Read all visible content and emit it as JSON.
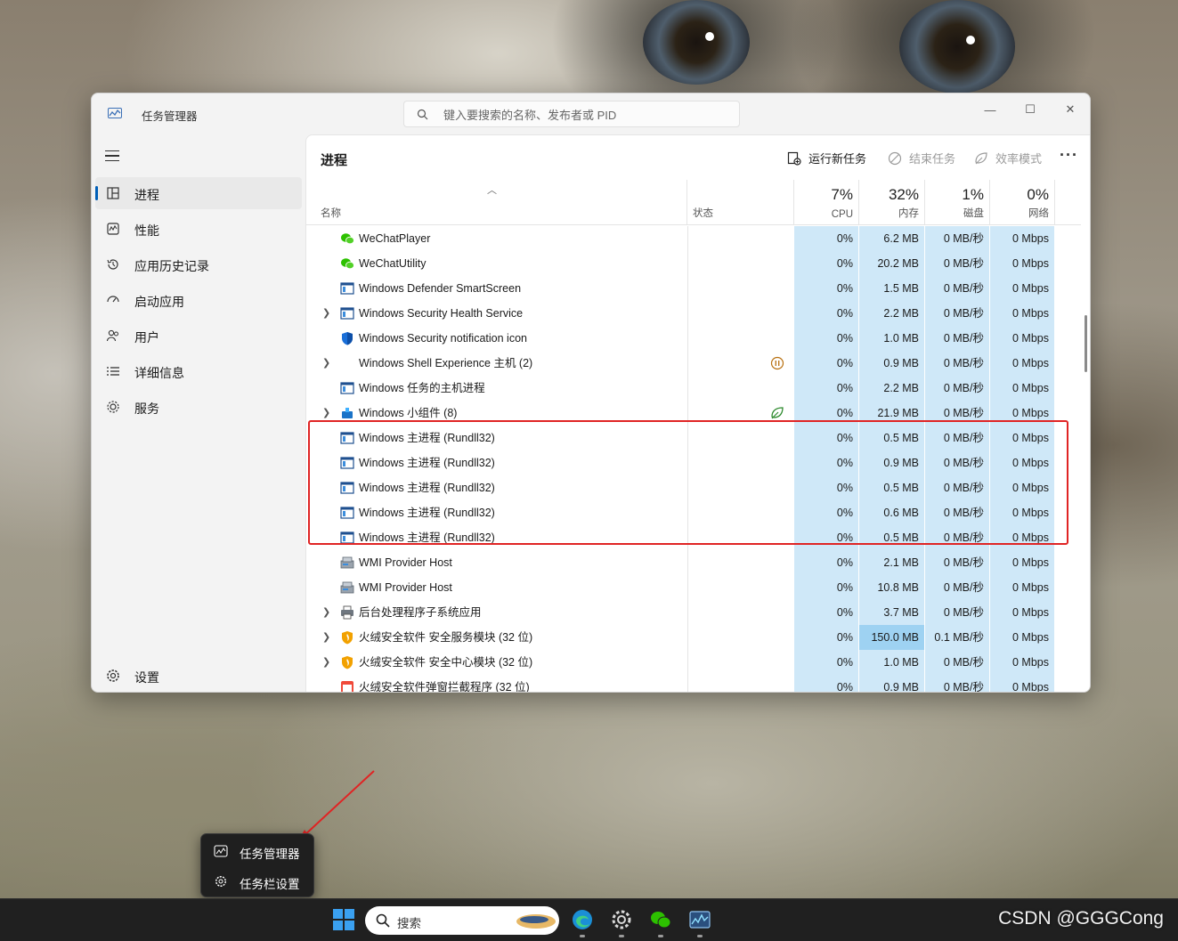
{
  "window": {
    "title": "任务管理器",
    "search_placeholder": "键入要搜索的名称、发布者或 PID",
    "minimize": "—",
    "maximize": "☐",
    "close": "✕"
  },
  "sidebar": {
    "items": [
      {
        "label": "进程",
        "icon": "processes-icon"
      },
      {
        "label": "性能",
        "icon": "performance-icon"
      },
      {
        "label": "应用历史记录",
        "icon": "app-history-icon"
      },
      {
        "label": "启动应用",
        "icon": "startup-icon"
      },
      {
        "label": "用户",
        "icon": "users-icon"
      },
      {
        "label": "详细信息",
        "icon": "details-icon"
      },
      {
        "label": "服务",
        "icon": "services-icon"
      }
    ],
    "settings": "设置"
  },
  "main": {
    "title": "进程",
    "toolbar": {
      "run_new_task": "运行新任务",
      "end_task": "结束任务",
      "efficiency_mode": "效率模式",
      "more": "···"
    }
  },
  "columns": {
    "name": "名称",
    "status": "状态",
    "cpu": {
      "pct": "7%",
      "label": "CPU"
    },
    "memory": {
      "pct": "32%",
      "label": "内存"
    },
    "disk": {
      "pct": "1%",
      "label": "磁盘"
    },
    "network": {
      "pct": "0%",
      "label": "网络"
    }
  },
  "processes": [
    {
      "name": "WeChatPlayer",
      "expand": false,
      "icon": "wechat-icon",
      "status": "",
      "cpu": "0%",
      "mem": "6.2 MB",
      "disk": "0 MB/秒",
      "net": "0 Mbps"
    },
    {
      "name": "WeChatUtility",
      "expand": false,
      "icon": "wechat-icon",
      "status": "",
      "cpu": "0%",
      "mem": "20.2 MB",
      "disk": "0 MB/秒",
      "net": "0 Mbps"
    },
    {
      "name": "Windows Defender SmartScreen",
      "expand": false,
      "icon": "window-app-icon",
      "status": "",
      "cpu": "0%",
      "mem": "1.5 MB",
      "disk": "0 MB/秒",
      "net": "0 Mbps"
    },
    {
      "name": "Windows Security Health Service",
      "expand": true,
      "icon": "window-app-icon",
      "status": "",
      "cpu": "0%",
      "mem": "2.2 MB",
      "disk": "0 MB/秒",
      "net": "0 Mbps"
    },
    {
      "name": "Windows Security notification icon",
      "expand": false,
      "icon": "shield-icon",
      "status": "",
      "cpu": "0%",
      "mem": "1.0 MB",
      "disk": "0 MB/秒",
      "net": "0 Mbps"
    },
    {
      "name": "Windows Shell Experience 主机 (2)",
      "expand": true,
      "icon": "none",
      "status": "suspended",
      "cpu": "0%",
      "mem": "0.9 MB",
      "disk": "0 MB/秒",
      "net": "0 Mbps"
    },
    {
      "name": "Windows 任务的主机进程",
      "expand": false,
      "icon": "window-app-icon",
      "status": "",
      "cpu": "0%",
      "mem": "2.2 MB",
      "disk": "0 MB/秒",
      "net": "0 Mbps"
    },
    {
      "name": "Windows 小组件 (8)",
      "expand": true,
      "icon": "widgets-icon",
      "status": "efficiency",
      "cpu": "0%",
      "mem": "21.9 MB",
      "disk": "0 MB/秒",
      "net": "0 Mbps"
    },
    {
      "name": "Windows 主进程 (Rundll32)",
      "expand": false,
      "icon": "window-app-icon",
      "status": "",
      "cpu": "0%",
      "mem": "0.5 MB",
      "disk": "0 MB/秒",
      "net": "0 Mbps"
    },
    {
      "name": "Windows 主进程 (Rundll32)",
      "expand": false,
      "icon": "window-app-icon",
      "status": "",
      "cpu": "0%",
      "mem": "0.9 MB",
      "disk": "0 MB/秒",
      "net": "0 Mbps"
    },
    {
      "name": "Windows 主进程 (Rundll32)",
      "expand": false,
      "icon": "window-app-icon",
      "status": "",
      "cpu": "0%",
      "mem": "0.5 MB",
      "disk": "0 MB/秒",
      "net": "0 Mbps"
    },
    {
      "name": "Windows 主进程 (Rundll32)",
      "expand": false,
      "icon": "window-app-icon",
      "status": "",
      "cpu": "0%",
      "mem": "0.6 MB",
      "disk": "0 MB/秒",
      "net": "0 Mbps"
    },
    {
      "name": "Windows 主进程 (Rundll32)",
      "expand": false,
      "icon": "window-app-icon",
      "status": "",
      "cpu": "0%",
      "mem": "0.5 MB",
      "disk": "0 MB/秒",
      "net": "0 Mbps"
    },
    {
      "name": "WMI Provider Host",
      "expand": false,
      "icon": "wmi-icon",
      "status": "",
      "cpu": "0%",
      "mem": "2.1 MB",
      "disk": "0 MB/秒",
      "net": "0 Mbps"
    },
    {
      "name": "WMI Provider Host",
      "expand": false,
      "icon": "wmi-icon",
      "status": "",
      "cpu": "0%",
      "mem": "10.8 MB",
      "disk": "0 MB/秒",
      "net": "0 Mbps"
    },
    {
      "name": "后台处理程序子系统应用",
      "expand": true,
      "icon": "printer-icon",
      "status": "",
      "cpu": "0%",
      "mem": "3.7 MB",
      "disk": "0 MB/秒",
      "net": "0 Mbps"
    },
    {
      "name": "火绒安全软件 安全服务模块 (32 位)",
      "expand": true,
      "icon": "huorong-icon",
      "status": "",
      "cpu": "0%",
      "mem": "150.0 MB",
      "disk": "0.1 MB/秒",
      "net": "0 Mbps",
      "hot": true
    },
    {
      "name": "火绒安全软件 安全中心模块 (32 位)",
      "expand": true,
      "icon": "huorong-icon",
      "status": "",
      "cpu": "0%",
      "mem": "1.0 MB",
      "disk": "0 MB/秒",
      "net": "0 Mbps"
    },
    {
      "name": "火绒安全软件弹窗拦截程序 (32 位)",
      "expand": false,
      "icon": "popup-block-icon",
      "status": "",
      "cpu": "0%",
      "mem": "0.9 MB",
      "disk": "0 MB/秒",
      "net": "0 Mbps"
    }
  ],
  "context_menu": {
    "items": [
      {
        "label": "任务管理器",
        "icon": "task-manager-icon"
      },
      {
        "label": "任务栏设置",
        "icon": "gear-icon"
      }
    ]
  },
  "taskbar": {
    "search_label": "搜索"
  },
  "watermark": "CSDN @GGGCong",
  "colors": {
    "accent": "#005fb8",
    "heat_low": "#cfe8f8",
    "heat_high": "#9ed2f2",
    "highlight_box": "#e02424"
  }
}
